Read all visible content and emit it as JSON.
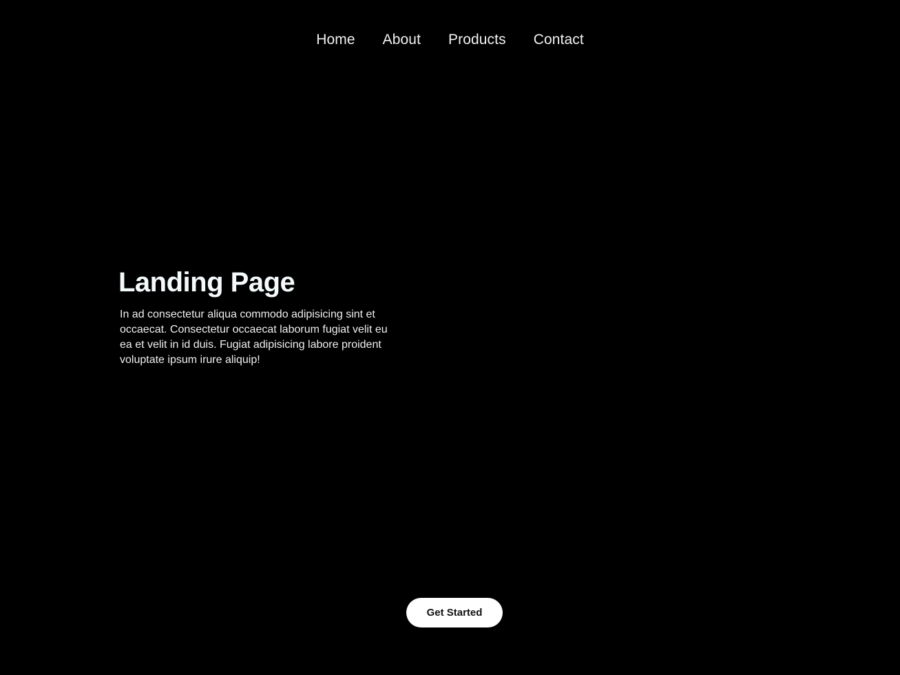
{
  "nav": {
    "items": [
      {
        "label": "Home"
      },
      {
        "label": "About"
      },
      {
        "label": "Products"
      },
      {
        "label": "Contact"
      }
    ]
  },
  "hero": {
    "title": "Landing Page",
    "body": "In ad consectetur aliqua commodo adipisicing sint et occaecat. Consectetur occaecat laborum fugiat velit eu ea et velit in id duis. Fugiat adipisicing labore proident voluptate ipsum irure aliquip!"
  },
  "cta": {
    "label": "Get Started"
  },
  "theme": {
    "background": "#000000",
    "text": "#ffffff",
    "button_bg": "#ffffff",
    "button_text": "#111111",
    "wave_colors": {
      "blue": "#2f4bff",
      "bright_blue": "#1e6bff",
      "red": "#e0281e",
      "orange": "#f08a2a",
      "yellow": "#d9c23a",
      "green": "#3fa04a"
    }
  }
}
